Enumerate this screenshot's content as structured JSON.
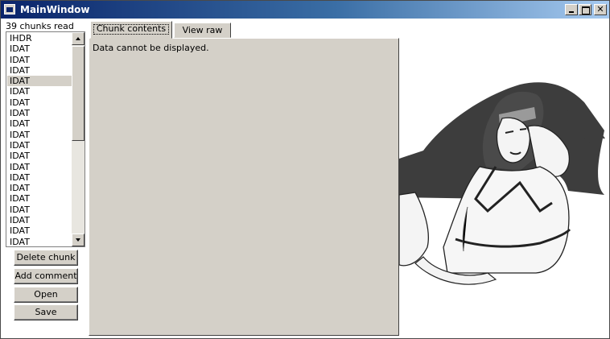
{
  "window": {
    "title": "MainWindow"
  },
  "status": {
    "text": "39 chunks read"
  },
  "chunk_list": {
    "items": [
      "IHDR",
      "IDAT",
      "IDAT",
      "IDAT",
      "IDAT",
      "IDAT",
      "IDAT",
      "IDAT",
      "IDAT",
      "IDAT",
      "IDAT",
      "IDAT",
      "IDAT",
      "IDAT",
      "IDAT",
      "IDAT",
      "IDAT",
      "IDAT",
      "IDAT",
      "IDAT"
    ],
    "selected_index": 4
  },
  "actions": {
    "delete_label": "Delete chunk",
    "comment_label": "Add comment",
    "open_label": "Open",
    "save_label": "Save"
  },
  "tabs": [
    {
      "label": "Chunk contents",
      "active": true
    },
    {
      "label": "View raw",
      "active": false
    }
  ],
  "panel": {
    "message": "Data cannot be displayed."
  },
  "image": {
    "description_icon": "illustration-image",
    "ink_color": "#3d3d3d"
  }
}
